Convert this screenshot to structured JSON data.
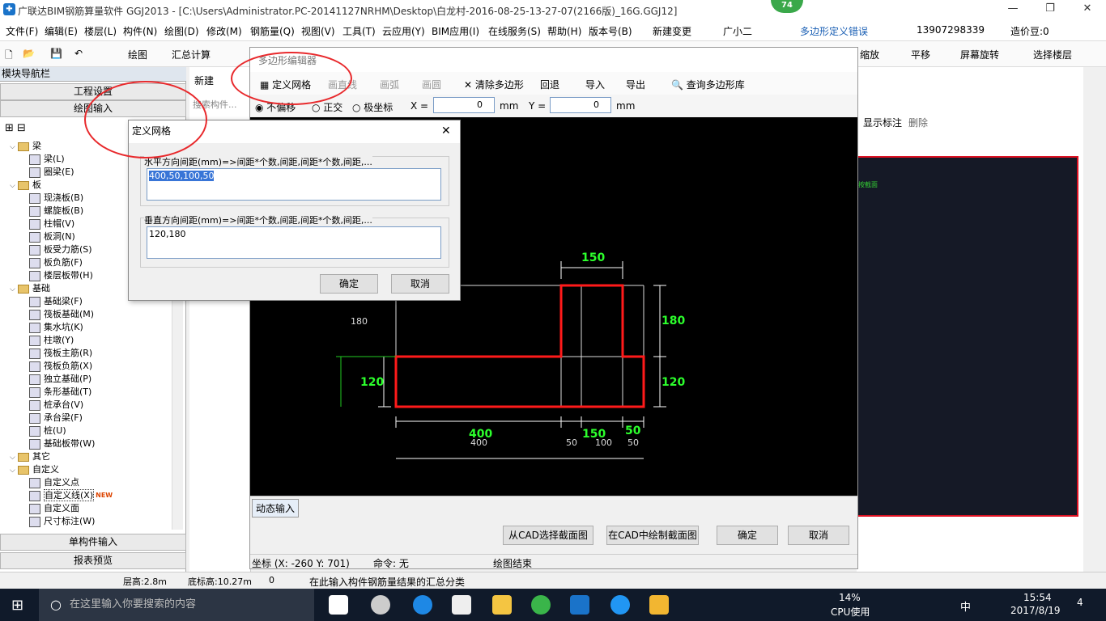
{
  "app": {
    "title": "广联达BIM钢筋算量软件 GGJ2013 - [C:\\Users\\Administrator.PC-20141127NRHM\\Desktop\\白龙村-2016-08-25-13-27-07(2166版)_16G.GGJ12]",
    "badge": "74"
  },
  "menu": [
    "文件(F)",
    "编辑(E)",
    "楼层(L)",
    "构件(N)",
    "绘图(D)",
    "修改(M)",
    "钢筋量(Q)",
    "视图(V)",
    "工具(T)",
    "云应用(Y)",
    "BIM应用(I)",
    "在线服务(S)",
    "帮助(H)",
    "版本号(B)",
    "新建变更",
    "广小二"
  ],
  "menu_notice": "多边形定义错误",
  "user": {
    "phone": "13907298339",
    "credit": "造价豆:0"
  },
  "toolbar": {
    "draw": "绘图",
    "sum": "汇总计算",
    "zoom": "缩放",
    "pan": "平移",
    "rotate": "屏幕旋转",
    "select_floor": "选择楼层"
  },
  "nav": {
    "title": "模块导航栏",
    "pin": "ᵖ ×",
    "project_settings": "工程设置",
    "draw_input": "绘图输入",
    "single_input": "单构件输入",
    "report": "报表预览"
  },
  "tree": [
    {
      "label": "梁",
      "type": "folder",
      "level": 0
    },
    {
      "label": "梁(L)",
      "type": "item",
      "level": 1
    },
    {
      "label": "圈梁(E)",
      "type": "item",
      "level": 1
    },
    {
      "label": "板",
      "type": "folder",
      "level": 0
    },
    {
      "label": "现浇板(B)",
      "type": "item",
      "level": 1
    },
    {
      "label": "螺旋板(B)",
      "type": "item",
      "level": 1
    },
    {
      "label": "柱帽(V)",
      "type": "item",
      "level": 1
    },
    {
      "label": "板洞(N)",
      "type": "item",
      "level": 1
    },
    {
      "label": "板受力筋(S)",
      "type": "item",
      "level": 1
    },
    {
      "label": "板负筋(F)",
      "type": "item",
      "level": 1
    },
    {
      "label": "楼层板带(H)",
      "type": "item",
      "level": 1
    },
    {
      "label": "基础",
      "type": "folder",
      "level": 0
    },
    {
      "label": "基础梁(F)",
      "type": "item",
      "level": 1
    },
    {
      "label": "筏板基础(M)",
      "type": "item",
      "level": 1
    },
    {
      "label": "集水坑(K)",
      "type": "item",
      "level": 1
    },
    {
      "label": "柱墩(Y)",
      "type": "item",
      "level": 1
    },
    {
      "label": "筏板主筋(R)",
      "type": "item",
      "level": 1
    },
    {
      "label": "筏板负筋(X)",
      "type": "item",
      "level": 1
    },
    {
      "label": "独立基础(P)",
      "type": "item",
      "level": 1
    },
    {
      "label": "条形基础(T)",
      "type": "item",
      "level": 1
    },
    {
      "label": "桩承台(V)",
      "type": "item",
      "level": 1
    },
    {
      "label": "承台梁(F)",
      "type": "item",
      "level": 1
    },
    {
      "label": "桩(U)",
      "type": "item",
      "level": 1
    },
    {
      "label": "基础板带(W)",
      "type": "item",
      "level": 1
    },
    {
      "label": "其它",
      "type": "folder",
      "level": 0
    },
    {
      "label": "自定义",
      "type": "folder",
      "level": 0
    },
    {
      "label": "自定义点",
      "type": "item",
      "level": 1
    },
    {
      "label": "自定义线(X)",
      "type": "item",
      "level": 1
    },
    {
      "label": "自定义面",
      "type": "item",
      "level": 1
    },
    {
      "label": "尺寸标注(W)",
      "type": "item",
      "level": 1
    }
  ],
  "tree_new_badge": "NEW",
  "mid": {
    "new": "新建",
    "search": "搜索构件..."
  },
  "cad": {
    "title": "多边形编辑器",
    "define_grid": "定义网格",
    "line": "画直线",
    "arc": "画弧",
    "circle": "画圆",
    "clear": "清除多边形",
    "undo": "回退",
    "import": "导入",
    "export": "导出",
    "query": "查询多边形库",
    "no_offset": "不偏移",
    "ortho": "正交",
    "polar": "极坐标",
    "x_label": "X =",
    "y_label": "Y =",
    "x_val": "0",
    "y_val": "0",
    "unit": "mm",
    "dynamic_input": "动态输入",
    "from_cad": "从CAD选择截面图",
    "draw_in_cad": "在CAD中绘制截面图",
    "ok": "确定",
    "cancel": "取消",
    "coord": "坐标 (X: -260 Y: 701)",
    "command": "命令: 无",
    "status": "绘图结束"
  },
  "canvas_labels": {
    "top150": "150",
    "r180": "180",
    "r120": "120",
    "l180": "180",
    "l120": "120",
    "b400": "400",
    "b400w": "400",
    "b150": "150",
    "b50": "50",
    "b50w": "50",
    "b100w": "100",
    "b50w2": "50"
  },
  "right": {
    "show_label": "显示标注",
    "delete": "删除",
    "green_text": "按截面"
  },
  "dialog": {
    "title": "定义网格",
    "h_label": "水平方向间距(mm)=>间距*个数,间距,间距*个数,间距,...",
    "h_value": "400,50,100,50",
    "v_label": "垂直方向间距(mm)=>间距*个数,间距,间距*个数,间距,...",
    "v_value": "120,180",
    "ok": "确定",
    "cancel": "取消"
  },
  "status": {
    "floor_height": "层高:2.8m",
    "base_height": "底标高:10.27m",
    "zero": "0",
    "hint": "在此输入构件钢筋量结果的汇总分类"
  },
  "taskbar": {
    "search": "在这里输入你要搜索的内容",
    "cpu": "14%",
    "cpu_label": "CPU使用",
    "time": "15:54",
    "date": "2017/8/19",
    "ime": "中",
    "notif": "4"
  }
}
